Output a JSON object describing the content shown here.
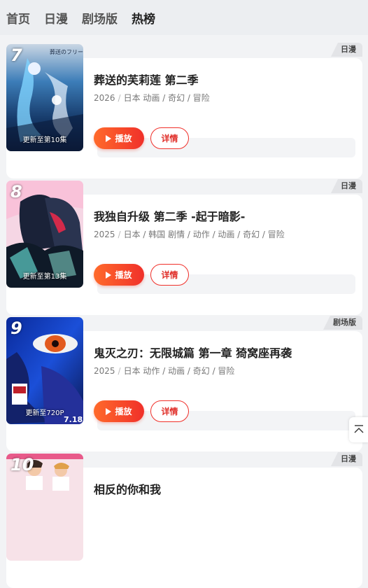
{
  "nav": {
    "tabs": [
      {
        "label": "首页"
      },
      {
        "label": "日漫"
      },
      {
        "label": "剧场版"
      },
      {
        "label": "热榜"
      }
    ]
  },
  "cards": [
    {
      "rank": "7",
      "tag": "日漫",
      "update": "更新至第10集",
      "title": "葬送的芙莉莲 第二季",
      "year": "2026",
      "meta": "日本 动画 / 奇幻 / 冒险",
      "play": "播放",
      "detail": "详情",
      "poster_colors": [
        "#1e2a4a",
        "#2f7fc0",
        "#6fd0ff"
      ]
    },
    {
      "rank": "8",
      "tag": "日漫",
      "update": "更新至第13集",
      "title": "我独自升级 第二季 -起于暗影-",
      "year": "2025",
      "meta": "日本 / 韩国 剧情 / 动作 / 动画 / 奇幻 / 冒险",
      "play": "播放",
      "detail": "详情",
      "poster_colors": [
        "#f6d7e6",
        "#20304a",
        "#d2264a"
      ]
    },
    {
      "rank": "9",
      "tag": "剧场版",
      "update": "更新至720P",
      "title": "鬼灭之刃：无限城篇 第一章 猗窝座再袭",
      "year": "2025",
      "meta": "日本 动作 / 动画 / 奇幻 / 冒险",
      "play": "播放",
      "detail": "详情",
      "poster_colors": [
        "#0b1a5a",
        "#1e55d8",
        "#e04a1a"
      ]
    },
    {
      "rank": "10",
      "tag": "日漫",
      "title": "相反的你和我",
      "poster_colors": [
        "#f4d8e0",
        "#e85a8a",
        "#ffffff"
      ]
    }
  ],
  "poster_texts": {
    "frieren": "葬送のフリーレン",
    "kimetsu_date": "7.18"
  },
  "accent": "#f0302a",
  "totop_icon": "arrow-up-to-top-icon"
}
